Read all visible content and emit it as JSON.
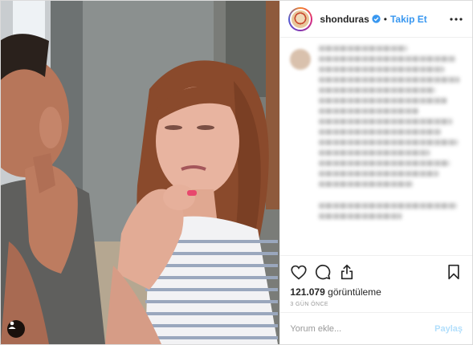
{
  "header": {
    "username": "shonduras",
    "verified": true,
    "separator": "•",
    "follow_label": "Takip Et",
    "more_icon": "more-dots-icon"
  },
  "caption": {
    "blurred": true
  },
  "actions": {
    "like_icon": "heart-icon",
    "comment_icon": "comment-icon",
    "share_icon": "share-icon",
    "save_icon": "bookmark-icon"
  },
  "stats": {
    "view_count": "121.079",
    "view_label": "görüntüleme",
    "timestamp": "3 GÜN ÖNCE"
  },
  "comment": {
    "placeholder": "Yorum ekle...",
    "post_label": "Paylaş"
  },
  "media": {
    "user_tag_icon": "user-tag-icon"
  },
  "colors": {
    "accent": "#3897f0",
    "post_disabled": "#b2dffc",
    "muted": "#999999",
    "border": "#efefef"
  }
}
